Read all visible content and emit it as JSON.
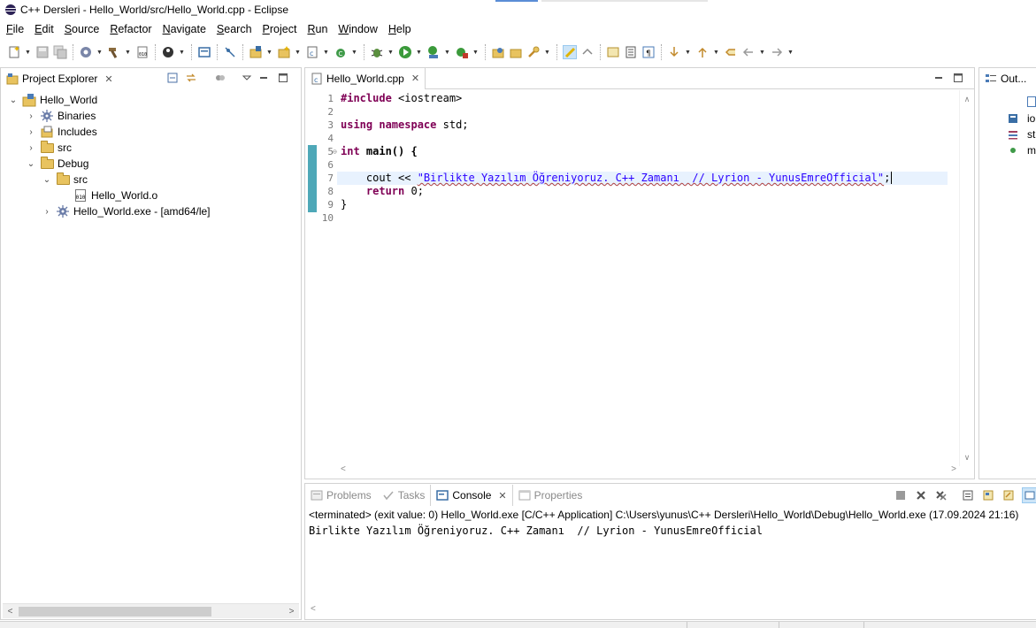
{
  "window": {
    "title": "C++ Dersleri - Hello_World/src/Hello_World.cpp - Eclipse"
  },
  "menu": [
    "File",
    "Edit",
    "Source",
    "Refactor",
    "Navigate",
    "Search",
    "Project",
    "Run",
    "Window",
    "Help"
  ],
  "explorer": {
    "tab_label": "Project Explorer",
    "close_glyph": "✕",
    "tree": [
      {
        "label": "Hello_World",
        "expanded": true
      },
      {
        "label": "Binaries",
        "expanded": false
      },
      {
        "label": "Includes",
        "expanded": false
      },
      {
        "label": "src",
        "expanded": false
      },
      {
        "label": "Debug",
        "expanded": true
      },
      {
        "label": "src",
        "expanded": true
      },
      {
        "label": "Hello_World.o"
      },
      {
        "label": "Hello_World.exe - [amd64/le]",
        "expanded": false
      }
    ],
    "file_icon_text": "010"
  },
  "editor": {
    "tab_label": "Hello_World.cpp",
    "close_glyph": "✕",
    "line_numbers": [
      "1",
      "2",
      "3",
      "4",
      "5",
      "6",
      "7",
      "8",
      "9",
      "10"
    ],
    "code": {
      "l1_kw": "#include",
      "l1_rest": " <iostream>",
      "l3_kw1": "using",
      "l3_kw2": "namespace",
      "l3_rest": " std;",
      "l5_kw": "int",
      "l5_rest": " main() {",
      "l7_pre": "    cout << ",
      "l7_str": "\"Birlikte Yazılım Öğreniyoruz. C++ Zamanı  // Lyrion - YunusEmreOfficial\"",
      "l7_end": ";",
      "l8_kw": "return",
      "l8_rest": " 0;",
      "l9": "}"
    }
  },
  "outline": {
    "tab_label": "Out...",
    "items": [
      "io",
      "st",
      "m"
    ]
  },
  "console": {
    "tabs": [
      "Problems",
      "Tasks",
      "Console",
      "Properties"
    ],
    "close_glyph": "✕",
    "header": "<terminated> (exit value: 0) Hello_World.exe [C/C++ Application] C:\\Users\\yunus\\C++ Dersleri\\Hello_World\\Debug\\Hello_World.exe (17.09.2024 21:16)",
    "output": "Birlikte Yazılım Öğreniyoruz. C++ Zamanı  // Lyrion - YunusEmreOfficial"
  },
  "colors": {
    "keyword": "#7f0055",
    "string": "#2a00ff",
    "change_bar": "#4ea8b8",
    "current_line": "#e8f2fe"
  }
}
